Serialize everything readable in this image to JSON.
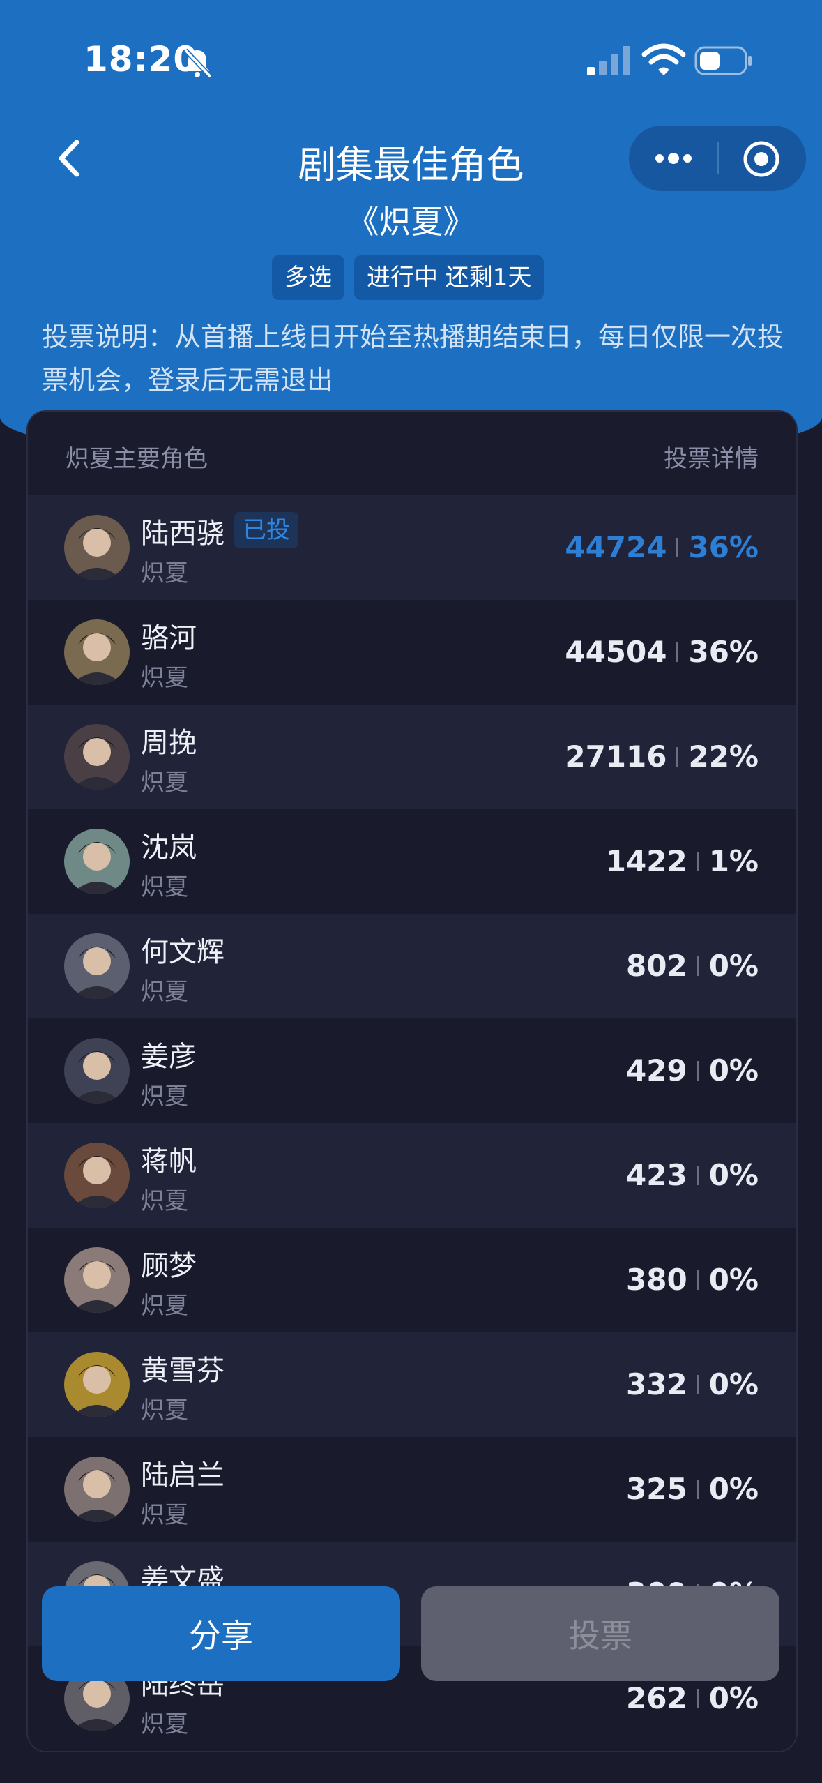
{
  "status_bar": {
    "time": "18:20"
  },
  "header": {
    "title": "剧集最佳角色",
    "drama": "《炽夏》",
    "tags": [
      "多选",
      "进行中 还剩1天"
    ],
    "notice": "投票说明：从首播上线日开始至热播期结束日，每日仅限一次投票机会，登录后无需退出"
  },
  "table": {
    "left_header": "炽夏主要角色",
    "right_header": "投票详情",
    "voted_label": "已投",
    "rows": [
      {
        "name": "陆西骁",
        "drama": "炽夏",
        "votes": "44724",
        "percent": "36%",
        "voted": true,
        "avatar_color": "#6b5a4e"
      },
      {
        "name": "骆河",
        "drama": "炽夏",
        "votes": "44504",
        "percent": "36%",
        "avatar_color": "#7a6a50"
      },
      {
        "name": "周挽",
        "drama": "炽夏",
        "votes": "27116",
        "percent": "22%",
        "avatar_color": "#4a3f44"
      },
      {
        "name": "沈岚",
        "drama": "炽夏",
        "votes": "1422",
        "percent": "1%",
        "avatar_color": "#6f8a86"
      },
      {
        "name": "何文辉",
        "drama": "炽夏",
        "votes": "802",
        "percent": "0%",
        "avatar_color": "#5b5f70"
      },
      {
        "name": "姜彦",
        "drama": "炽夏",
        "votes": "429",
        "percent": "0%",
        "avatar_color": "#3f4255"
      },
      {
        "name": "蒋帆",
        "drama": "炽夏",
        "votes": "423",
        "percent": "0%",
        "avatar_color": "#6a4a3c"
      },
      {
        "name": "顾梦",
        "drama": "炽夏",
        "votes": "380",
        "percent": "0%",
        "avatar_color": "#8a7b78"
      },
      {
        "name": "黄雪芬",
        "drama": "炽夏",
        "votes": "332",
        "percent": "0%",
        "avatar_color": "#a98a2e"
      },
      {
        "name": "陆启兰",
        "drama": "炽夏",
        "votes": "325",
        "percent": "0%",
        "avatar_color": "#7d7070"
      },
      {
        "name": "姜文盛",
        "drama": "炽夏",
        "votes": "309",
        "percent": "0%",
        "avatar_color": "#6a6a72"
      },
      {
        "name": "陆终岳",
        "drama": "炽夏",
        "votes": "262",
        "percent": "0%",
        "avatar_color": "#5f5d66"
      }
    ]
  },
  "actions": {
    "share_label": "分享",
    "vote_label": "投票"
  },
  "colors": {
    "accent": "#1c6fc1",
    "background": "#191a2b",
    "highlight_text": "#2d7fd6"
  }
}
